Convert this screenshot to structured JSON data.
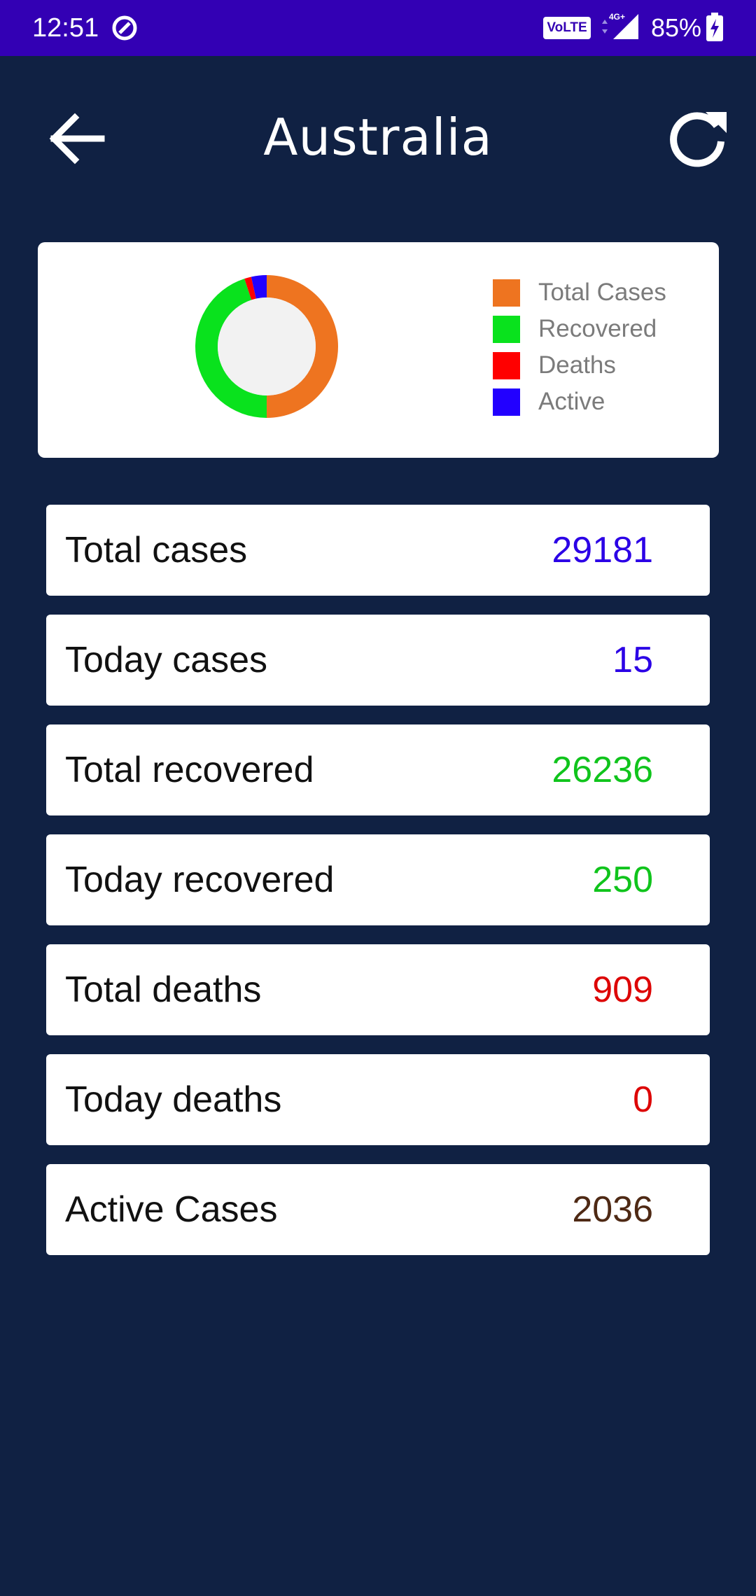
{
  "status_bar": {
    "time": "12:51",
    "volte_label": "VoLTE",
    "network_label": "4G+",
    "battery_percent": "85%"
  },
  "header": {
    "title": "Australia",
    "back_icon": "arrow-left-icon",
    "refresh_icon": "refresh-icon"
  },
  "chart_data": {
    "type": "pie",
    "style": "donut",
    "categories": [
      "Total Cases",
      "Recovered",
      "Deaths",
      "Active"
    ],
    "values": [
      29181,
      26236,
      909,
      2036
    ],
    "colors": [
      "#ee7420",
      "#09e21d",
      "#ff0000",
      "#2200ff"
    ],
    "legend_position": "right"
  },
  "stats": [
    {
      "label": "Total cases",
      "value": "29181",
      "color": "#2b00e6"
    },
    {
      "label": "Today cases",
      "value": "15",
      "color": "#2b00e6"
    },
    {
      "label": "Total recovered",
      "value": "26236",
      "color": "#10c41c"
    },
    {
      "label": "Today recovered",
      "value": "250",
      "color": "#10c41c"
    },
    {
      "label": "Total deaths",
      "value": "909",
      "color": "#dd0505"
    },
    {
      "label": "Today deaths",
      "value": "0",
      "color": "#dd0505"
    },
    {
      "label": "Active Cases",
      "value": "2036",
      "color": "#4e2914"
    }
  ]
}
